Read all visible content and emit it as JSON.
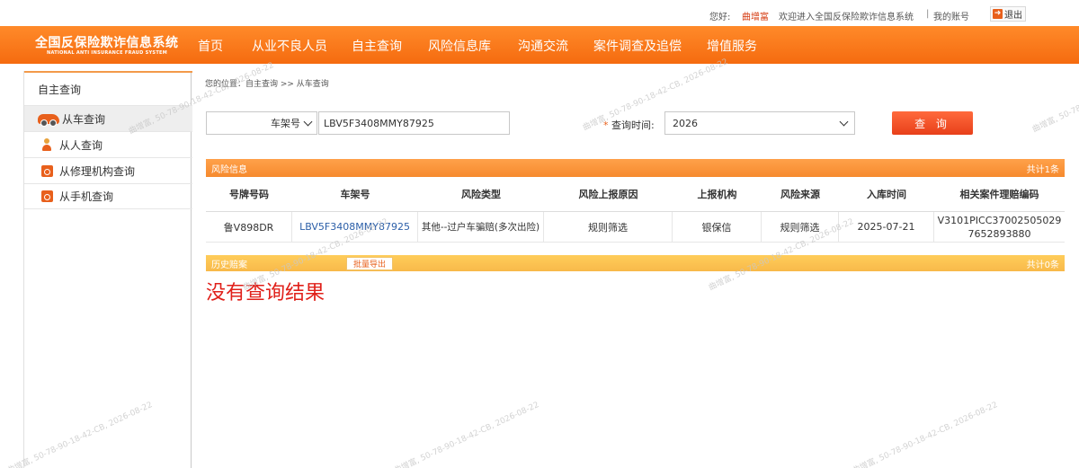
{
  "userbar": {
    "greeting": "您好:",
    "username": "曲增富",
    "welcome": "欢迎进入全国反保险欺诈信息系统",
    "separator": "|",
    "my_account": "我的账号",
    "logout": "退出"
  },
  "brand": {
    "name_cn": "全国反保险欺诈信息系统",
    "name_en": "NATIONAL ANTI INSURANCE FRAUD SYSTEM"
  },
  "nav": {
    "items": [
      "首页",
      "从业不良人员",
      "自主查询",
      "风险信息库",
      "沟通交流",
      "案件调查及追偿",
      "增值服务"
    ]
  },
  "sidebar": {
    "title": "自主查询",
    "items": [
      {
        "label": "从车查询",
        "icon": "car-icon",
        "active": true
      },
      {
        "label": "从人查询",
        "icon": "person-icon",
        "active": false
      },
      {
        "label": "从修理机构查询",
        "icon": "repair-icon",
        "active": false
      },
      {
        "label": "从手机查询",
        "icon": "phone-icon",
        "active": false
      }
    ]
  },
  "breadcrumb": "您的位置：自主查询 >> 从车查询",
  "search": {
    "type_value": "车架号",
    "vin_value": "LBV5F3408MMY87925",
    "time_label_star": "*",
    "time_label": "查询时间:",
    "time_value": "2026",
    "query_button": "查 询"
  },
  "risk": {
    "title": "风险信息",
    "count": "共计1条",
    "columns": [
      "号牌号码",
      "车架号",
      "风险类型",
      "风险上报原因",
      "上报机构",
      "风险来源",
      "入库时间",
      "相关案件理赔编码"
    ],
    "rows": [
      [
        "鲁V898DR",
        "LBV5F3408MMY87925",
        "其他--过户车骗赔(多次出险)",
        "规则筛选",
        "银保信",
        "规则筛选",
        "2025-07-21",
        "V3101PICC370025050297652893880"
      ]
    ]
  },
  "history": {
    "title": "历史赔案",
    "export_button": "批量导出",
    "count": "共计0条",
    "empty_message": "没有查询结果"
  },
  "watermark": {
    "text": "曲增富, 50-78-90-18-42-CB, 2026-08-22",
    "color": "#c8c8c8"
  }
}
